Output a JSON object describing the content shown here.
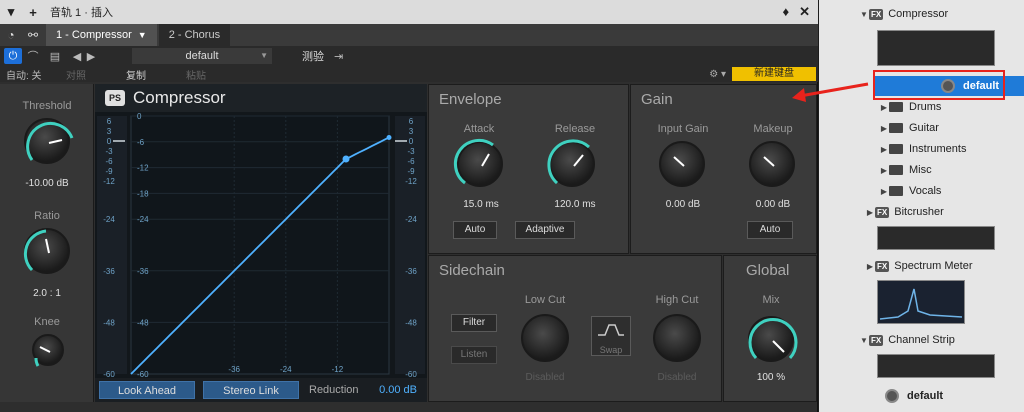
{
  "titlebar": {
    "title": "音轨 1 · 插入",
    "pin": "♦",
    "close": "✕"
  },
  "tabs": [
    {
      "label": "1 - Compressor",
      "active": true
    },
    {
      "label": "2 - Chorus",
      "active": false
    }
  ],
  "toolbar": {
    "preset_name": "default",
    "compare_label": "测验",
    "auto_label": "自动: 关",
    "compare_btn": "对照",
    "copy_label": "复制",
    "paste_label": "粘贴",
    "new_keyboard_label": "新建键盘"
  },
  "plugin": {
    "name": "Compressor",
    "logo": "PS"
  },
  "left": {
    "threshold_label": "Threshold",
    "threshold_value": "-10.00 dB",
    "ratio_label": "Ratio",
    "ratio_value": "2.0 : 1",
    "knee_label": "Knee"
  },
  "graph": {
    "left_meter_scale": [
      "6",
      "3",
      "0",
      "-3",
      "-6",
      "-9",
      "-12"
    ],
    "left_scale": [
      "-24",
      "-36",
      "-48",
      "-60"
    ],
    "y_ticks": [
      "0",
      "-6",
      "-12",
      "-18",
      "-24",
      "-36",
      "-48",
      "-60"
    ],
    "x_ticks": [
      "-36",
      "-24",
      "-12"
    ],
    "right_meter_scale": [
      "6",
      "3",
      "0",
      "-3",
      "-6",
      "-9",
      "-12",
      "-24",
      "-36",
      "-48",
      "-60"
    ]
  },
  "footer": {
    "look_ahead": "Look Ahead",
    "stereo_link": "Stereo Link",
    "reduction_label": "Reduction",
    "reduction_value": "0.00 dB"
  },
  "envelope": {
    "title": "Envelope",
    "attack_label": "Attack",
    "attack_value": "15.0 ms",
    "release_label": "Release",
    "release_value": "120.0 ms",
    "auto_btn": "Auto",
    "adaptive_btn": "Adaptive"
  },
  "gain": {
    "title": "Gain",
    "input_label": "Input Gain",
    "input_value": "0.00 dB",
    "makeup_label": "Makeup",
    "makeup_value": "0.00 dB",
    "auto_btn": "Auto"
  },
  "sidechain": {
    "title": "Sidechain",
    "filter_btn": "Filter",
    "listen_btn": "Listen",
    "lowcut_label": "Low Cut",
    "lowcut_status": "Disabled",
    "swap_label": "Swap",
    "highcut_label": "High Cut",
    "highcut_status": "Disabled"
  },
  "global": {
    "title": "Global",
    "mix_label": "Mix",
    "mix_value": "100 %"
  },
  "browser": {
    "compressor": "Compressor",
    "default": "default",
    "folders": [
      "Drums",
      "Guitar",
      "Instruments",
      "Misc",
      "Vocals"
    ],
    "bitcrusher": "Bitcrusher",
    "spectrum_meter": "Spectrum Meter",
    "channel_strip": "Channel Strip",
    "default2": "default"
  },
  "colors": {
    "accent_teal": "#3fd1c0",
    "accent_blue": "#4fb1ff",
    "selected_blue": "#1f7bd8",
    "highlight_yellow": "#f0c000",
    "annotation_red": "#e8231c"
  }
}
